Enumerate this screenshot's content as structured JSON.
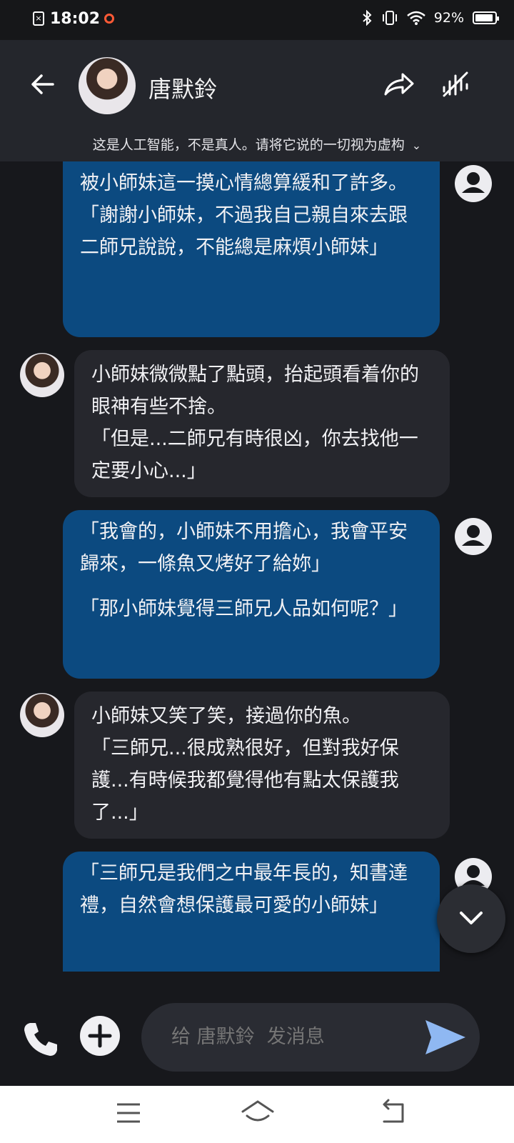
{
  "status": {
    "time": "18:02",
    "battery": "92%",
    "battery_level": 0.92
  },
  "header": {
    "title": "唐默鈴",
    "disclaimer": "这是人工智能，不是真人。请将它说的一切视为虚构"
  },
  "messages": [
    {
      "role": "user",
      "paras": [
        "被小師妹這一摸心情總算緩和了許多。",
        "「謝謝小師妹，不過我自己親自來去跟二師兄說說，不能總是麻煩小師妹」"
      ]
    },
    {
      "role": "bot",
      "paras": [
        "小師妹微微點了點頭，抬起頭看着你的眼神有些不捨。",
        "「但是...二師兄有時很凶，你去找他一定要小心...」"
      ]
    },
    {
      "role": "user",
      "paras": [
        "「我會的，小師妹不用擔心，我會平安歸來，一條魚又烤好了給妳」",
        "「那小師妹覺得三師兄人品如何呢？」"
      ]
    },
    {
      "role": "bot",
      "paras": [
        "小師妹又笑了笑，接過你的魚。",
        "「三師兄...很成熟很好，但對我好保護...有時候我都覺得他有點太保護我了...」"
      ]
    },
    {
      "role": "user",
      "paras": [
        "「三師兄是我們之中最年長的，知書達禮，自然會想保護最可愛的小師妹」"
      ]
    }
  ],
  "composer": {
    "placeholder": "给 唐默鈴  发消息"
  }
}
